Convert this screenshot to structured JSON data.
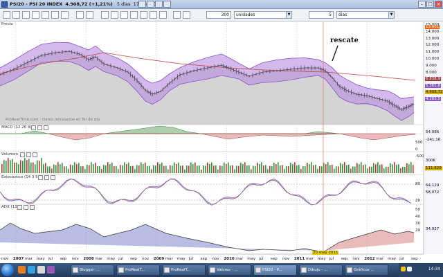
{
  "window": {
    "title_symbol": "PSI20 - PSI 20 INDEX",
    "title_quote": "4.908,72 (+1,21%)",
    "title_period": "5 dias",
    "title_date": "17 ago 2012"
  },
  "toolbar": {
    "units_value": "300",
    "units_type": "unidades",
    "period_value": "5",
    "period_type": "dias"
  },
  "panels": {
    "price": {
      "label": "Precio",
      "watermark": "ProRealTime.com - Datos retrasados en fin de día",
      "annotation": "rescate"
    },
    "macd": {
      "label": "MACD (12 26 9)"
    },
    "volume": {
      "label": "Volumen"
    },
    "stoch": {
      "label": "Estocástico (14 3 5)"
    },
    "adx": {
      "label": "ADX (13)"
    }
  },
  "price_axis": [
    "15.000",
    "14.000",
    "13.000",
    "12.000",
    "11.000",
    "10.000",
    "9.000",
    "8.000",
    "7.000",
    "6.000",
    "5.000",
    "4.000"
  ],
  "price_badges": [
    {
      "text": "13.661",
      "color": "#e06a1a"
    },
    {
      "text": "6.838,9",
      "color": "#9a3a3a"
    },
    {
      "text": "5.361,6",
      "color": "#8a5ac0"
    },
    {
      "text": "4.908,72",
      "color": "#d4b000"
    },
    {
      "text": "4.283,5",
      "color": "#8a5ac0"
    }
  ],
  "macd_axis": [
    "500",
    "0",
    "-500"
  ],
  "macd_badges": [
    {
      "text": "54.086",
      "color": "#333"
    },
    {
      "text": "-241,16",
      "color": "#333"
    }
  ],
  "volume_badges": [
    {
      "text": "300K",
      "color": "#333"
    },
    {
      "text": "111.820",
      "color": "#d4b000"
    }
  ],
  "stoch_axis": [
    "80",
    "20"
  ],
  "stoch_badges": [
    {
      "text": "64,129",
      "color": "#333"
    },
    {
      "text": "58,072",
      "color": "#333"
    }
  ],
  "adx_axis": [
    "50",
    "40",
    "30",
    "20"
  ],
  "adx_badges": [
    {
      "text": "34,927",
      "color": "#333"
    }
  ],
  "x_axis": [
    {
      "label": "nov",
      "major": false
    },
    {
      "label": "2007",
      "major": true
    },
    {
      "label": "mar",
      "major": false
    },
    {
      "label": "may",
      "major": false
    },
    {
      "label": "jul",
      "major": false
    },
    {
      "label": "sep",
      "major": false
    },
    {
      "label": "nov",
      "major": false
    },
    {
      "label": "2008",
      "major": true
    },
    {
      "label": "mar",
      "major": false
    },
    {
      "label": "may",
      "major": false
    },
    {
      "label": "jul",
      "major": false
    },
    {
      "label": "sep",
      "major": false
    },
    {
      "label": "nov",
      "major": false
    },
    {
      "label": "2009",
      "major": true
    },
    {
      "label": "mar",
      "major": false
    },
    {
      "label": "may",
      "major": false
    },
    {
      "label": "jul",
      "major": false
    },
    {
      "label": "sep",
      "major": false
    },
    {
      "label": "nov",
      "major": false
    },
    {
      "label": "2010",
      "major": true
    },
    {
      "label": "mar",
      "major": false
    },
    {
      "label": "may",
      "major": false
    },
    {
      "label": "jul",
      "major": false
    },
    {
      "label": "sep",
      "major": false
    },
    {
      "label": "nov",
      "major": false
    },
    {
      "label": "2011",
      "major": true
    },
    {
      "label": "mar",
      "major": false
    },
    {
      "label": "may",
      "major": false
    },
    {
      "label": "jul",
      "major": false
    },
    {
      "label": "sep",
      "major": false
    },
    {
      "label": "nov",
      "major": false
    },
    {
      "label": "2012",
      "major": true
    },
    {
      "label": "mar",
      "major": false
    },
    {
      "label": "may",
      "major": false
    },
    {
      "label": "jul",
      "major": false
    },
    {
      "label": "sep",
      "major": false
    }
  ],
  "cursor_date": "20 may 2011",
  "taskbar": {
    "items": [
      "Blogger: ...",
      "ProRealT...",
      "ProRealT...",
      "Valores - ...",
      "PSI20 - P...",
      "Dibujo - ...",
      "Gráficos ..."
    ],
    "active_index": 4,
    "clock": "14:34"
  },
  "colors": {
    "band_fill": "#b58ae0",
    "band_stroke": "#8a4fc7",
    "price_area": "#d4d4d4",
    "ma_line": "#c04040",
    "cursor_line": "#e07070",
    "up_bar": "#2a9a3a",
    "down_bar": "#c83030"
  }
}
